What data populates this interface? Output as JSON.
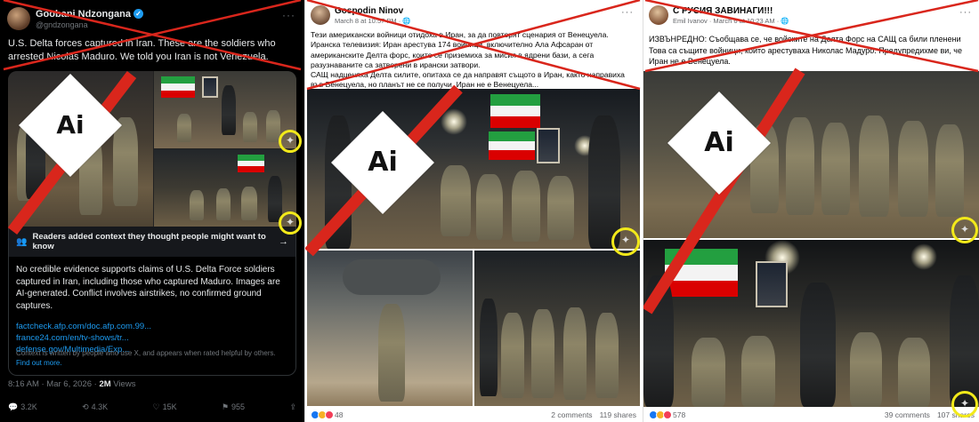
{
  "x_post": {
    "author_name": "Goobani Ndzongana",
    "author_handle": "@gndzongana",
    "more_label": "···",
    "text": "U.S. Delta forces captured in Iran. These are the soldiers who arrested Nicolás Maduro. We told you Iran is not Venezuela.",
    "ai_label": "Ai",
    "community_note": {
      "header": "Readers added context they thought people might want to know",
      "body": "No credible evidence supports claims of U.S. Delta Force soldiers captured in Iran, including those who captured Maduro. Images are AI-generated. Conflict involves airstrikes, no confirmed ground captures.",
      "links": [
        "factcheck.afp.com/doc.afp.com.99...",
        "france24.com/en/tv-shows/tr...",
        "defense.gov/Multimedia/Exp..."
      ],
      "footer": "Context is written by people who use X, and appears when rated helpful by others.",
      "footer_link": "Find out more."
    },
    "timestamp": "8:16 AM · Mar 6, 2026 · ",
    "views_count": "2M",
    "views_label": " Views",
    "actions": {
      "replies": "3.2K",
      "reposts": "4.3K",
      "likes": "15K",
      "bookmarks": "955"
    }
  },
  "fb_post_1": {
    "author_name": "Gospodin Ninov",
    "meta": "March 8 at 10:57 PM · ",
    "text": "Тези американски войници отидоха в Иран, за да повторят сценария от Венецуела.\nИранска телевизия: Иран арестува 174 войници, включително Ала Афсаран от американските Делта форс, които се приземиха за мисия в ядрени бази, а сега разузнаваните са затворени в ирански затвори.\nСАЩ надценяха Делта силите, опитаха се да направят същото в Иран, както направиха във Венецуела, но планът не се получи. Иран не е Венецуела...",
    "ai_label": "Ai",
    "reactions": "48",
    "comments": "2 comments",
    "shares": "119 shares"
  },
  "fb_post_2": {
    "author_name": "С РУСИЯ ЗАВИНАГИ!!!",
    "meta": "Emil Ivanov · March 6 at 10:23 AM · ",
    "text": "ИЗВЪНРЕДНО: Съобщава се, че войските на Делта Форс на САЩ са били пленени\nТова са същите войници, които арестуваха Николас Мадуро. Предупредихме ви, че Иран не е Венецуела.",
    "ai_label": "Ai",
    "reactions": "578",
    "comments": "39 comments",
    "shares": "107 shares"
  },
  "icons": {
    "reply": "speech-bubble",
    "repost": "loop-arrows",
    "like": "heart",
    "bookmark": "bookmark",
    "share": "upload-arrow",
    "sparkle": "four-point-star"
  },
  "colors": {
    "x_bg": "#000000",
    "x_link": "#1d9bf0",
    "red_cross": "#d9261c",
    "highlight_ring": "#f2e91a",
    "fb_text": "#050505"
  }
}
